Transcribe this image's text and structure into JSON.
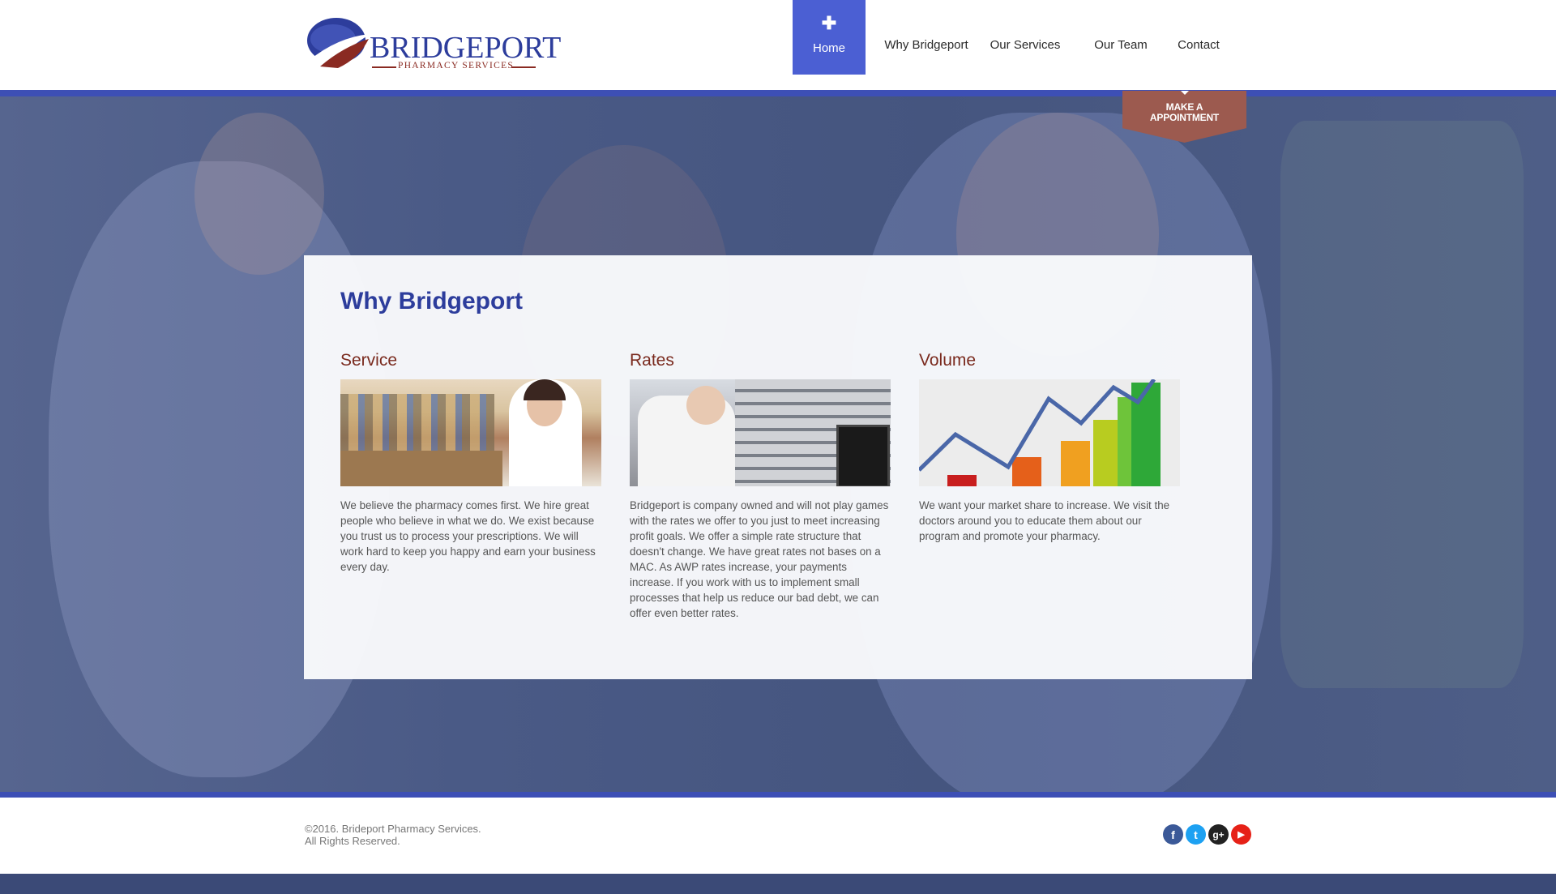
{
  "brand": {
    "name": "BRIDGEPORT",
    "subtitle": "PHARMACY SERVICES"
  },
  "nav": {
    "items": [
      {
        "label": "Home",
        "active": true
      },
      {
        "label": "Why Bridgeport",
        "active": false
      },
      {
        "label": "Our Services",
        "active": false
      },
      {
        "label": "Our Team",
        "active": false
      },
      {
        "label": "Contact",
        "active": false
      }
    ]
  },
  "appointment": {
    "line1": "MAKE A",
    "line2": "APPOINTMENT"
  },
  "panel": {
    "title": "Why Bridgeport",
    "columns": [
      {
        "heading": "Service",
        "text": "We believe the pharmacy comes first.  We hire great people who believe in what we do.  We exist because you trust us to process your prescriptions.  We will work hard to keep you happy and earn your business every day."
      },
      {
        "heading": "Rates",
        "text": "Bridgeport is company owned and will not play games with the rates we offer to you just to meet increasing profit goals.  We offer a simple rate structure that doesn't change.  We have great rates not bases on a MAC.  As AWP rates increase, your payments increase.  If you work with us to implement small processes that help us reduce our bad debt, we can offer even better rates."
      },
      {
        "heading": "Volume",
        "text": "We want your market share to increase.  We visit the doctors around you to educate them about our program and promote your pharmacy."
      }
    ]
  },
  "footer": {
    "copyright_line1": "©2016. Brideport Pharmacy Services.",
    "copyright_line2": "All Rights Reserved.",
    "social": [
      {
        "name": "facebook",
        "glyph": "f",
        "color": "#3b5998"
      },
      {
        "name": "twitter",
        "glyph": "t",
        "color": "#1da1f2"
      },
      {
        "name": "google-plus",
        "glyph": "g+",
        "color": "#222222"
      },
      {
        "name": "youtube",
        "glyph": "▶",
        "color": "#e62117"
      }
    ]
  },
  "colors": {
    "brand_blue": "#2d3d9c",
    "nav_active": "#4b5fd3",
    "accent_bar": "#3d4fb5",
    "heading_red": "#7a2a1e",
    "appointment": "#9c5a4f"
  }
}
